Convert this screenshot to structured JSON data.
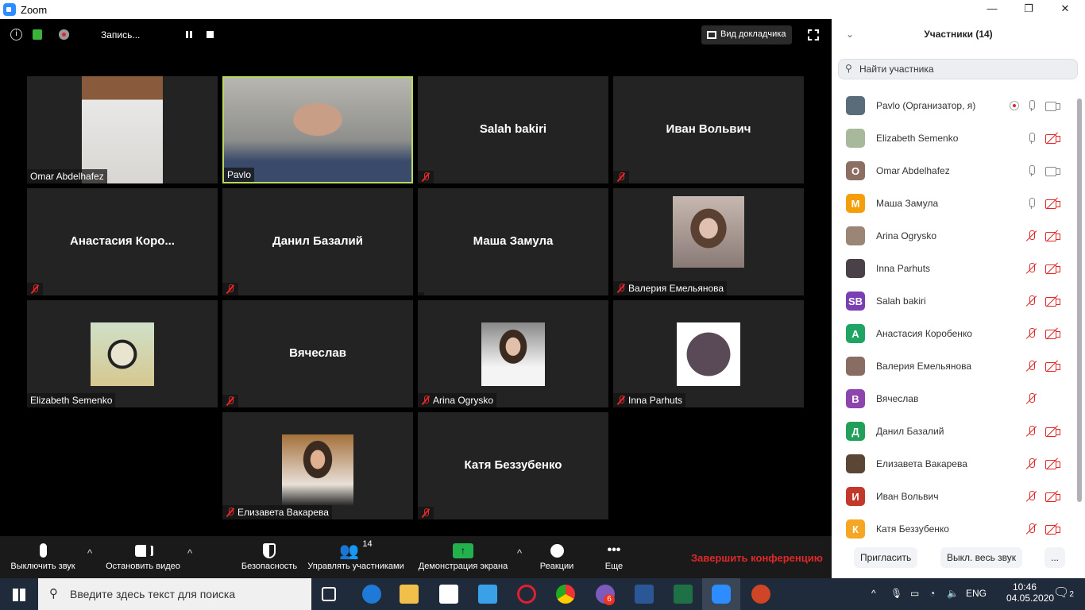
{
  "window": {
    "title": "Zoom",
    "minimize": "—",
    "maximize": "❐",
    "close": "✕"
  },
  "topbar": {
    "recording_label": "Запись...",
    "speaker_view": "Вид докладчика",
    "icons": [
      "info-icon",
      "encryption-lock-icon",
      "recording-dot-icon",
      "pause-icon",
      "stop-icon",
      "fullscreen-icon"
    ]
  },
  "tiles": [
    {
      "name": "Omar Abdelhafez",
      "video": true,
      "muted": false
    },
    {
      "name": "Pavlo",
      "video": true,
      "muted": false,
      "active": true
    },
    {
      "name": "Salah bakiri",
      "video": false,
      "muted": true
    },
    {
      "name": "Иван Вольвич",
      "video": false,
      "muted": true
    },
    {
      "name": "Анастасия  Коро...",
      "video": false,
      "muted": true
    },
    {
      "name": "Данил Базалий",
      "video": false,
      "muted": true
    },
    {
      "name": "Маша Замула",
      "video": false,
      "muted": false
    },
    {
      "name": "Валерия Емельянова",
      "video": true,
      "muted": true
    },
    {
      "name": "Elizabeth Semenko",
      "video": true,
      "muted": false
    },
    {
      "name": "Вячеслав",
      "video": false,
      "muted": true
    },
    {
      "name": "Arina Ogrysko",
      "video": true,
      "muted": true
    },
    {
      "name": "Inna Parhuts",
      "video": true,
      "muted": true
    },
    {
      "name": "Елизавета Вакарева",
      "video": true,
      "muted": true
    },
    {
      "name": "Катя Беззубенко",
      "video": false,
      "muted": true
    }
  ],
  "toolbar": {
    "mute": "Выключить звук",
    "stop_video": "Остановить видео",
    "security": "Безопасность",
    "participants": "Управлять участниками",
    "participants_count": "14",
    "share": "Демонстрация экрана",
    "reactions": "Реакции",
    "more": "Еще",
    "end": "Завершить конференцию"
  },
  "panel": {
    "title": "Участники (14)",
    "search_placeholder": "Найти участника",
    "invite": "Пригласить",
    "mute_all": "Выкл. весь звук",
    "more": "...",
    "participants": [
      {
        "name": "Pavlo (Организатор, я)",
        "avatar": "photo",
        "color": "#5a6b7a",
        "mic": "on",
        "cam": "on",
        "rec": true
      },
      {
        "name": "Elizabeth Semenko",
        "avatar": "photo",
        "color": "#a8b89a",
        "mic": "on",
        "cam": "off"
      },
      {
        "name": "Omar Abdelhafez",
        "avatar": "O",
        "color": "#8d6e63",
        "mic": "on",
        "cam": "on"
      },
      {
        "name": "Маша Замула",
        "avatar": "M",
        "color": "#f59e0b",
        "mic": "on",
        "cam": "off"
      },
      {
        "name": "Arina Ogrysko",
        "avatar": "photo",
        "color": "#9a8577",
        "mic": "off",
        "cam": "off"
      },
      {
        "name": "Inna Parhuts",
        "avatar": "photo",
        "color": "#4a4048",
        "mic": "off",
        "cam": "off"
      },
      {
        "name": "Salah bakiri",
        "avatar": "SB",
        "color": "#7b3fb5",
        "mic": "off",
        "cam": "off"
      },
      {
        "name": "Анастасия Коробенко",
        "avatar": "А",
        "color": "#1fa463",
        "mic": "off",
        "cam": "off"
      },
      {
        "name": "Валерия Емельянова",
        "avatar": "photo",
        "color": "#8a6d62",
        "mic": "off",
        "cam": "off"
      },
      {
        "name": "Вячеслав",
        "avatar": "В",
        "color": "#8e44ad",
        "mic": "off",
        "cam": "none"
      },
      {
        "name": "Данил Базалий",
        "avatar": "Д",
        "color": "#22a05a",
        "mic": "off",
        "cam": "off"
      },
      {
        "name": "Елизавета Вакарева",
        "avatar": "photo",
        "color": "#5b4636",
        "mic": "off",
        "cam": "off"
      },
      {
        "name": "Иван Вольвич",
        "avatar": "И",
        "color": "#c0392b",
        "mic": "off",
        "cam": "off"
      },
      {
        "name": "Катя Беззубенко",
        "avatar": "К",
        "color": "#f5a623",
        "mic": "off",
        "cam": "off"
      }
    ]
  },
  "taskbar": {
    "search_placeholder": "Введите здесь текст для поиска",
    "viber_badge": "6",
    "lang": "ENG",
    "time": "10:46",
    "date": "04.05.2020",
    "notifications": "2"
  }
}
